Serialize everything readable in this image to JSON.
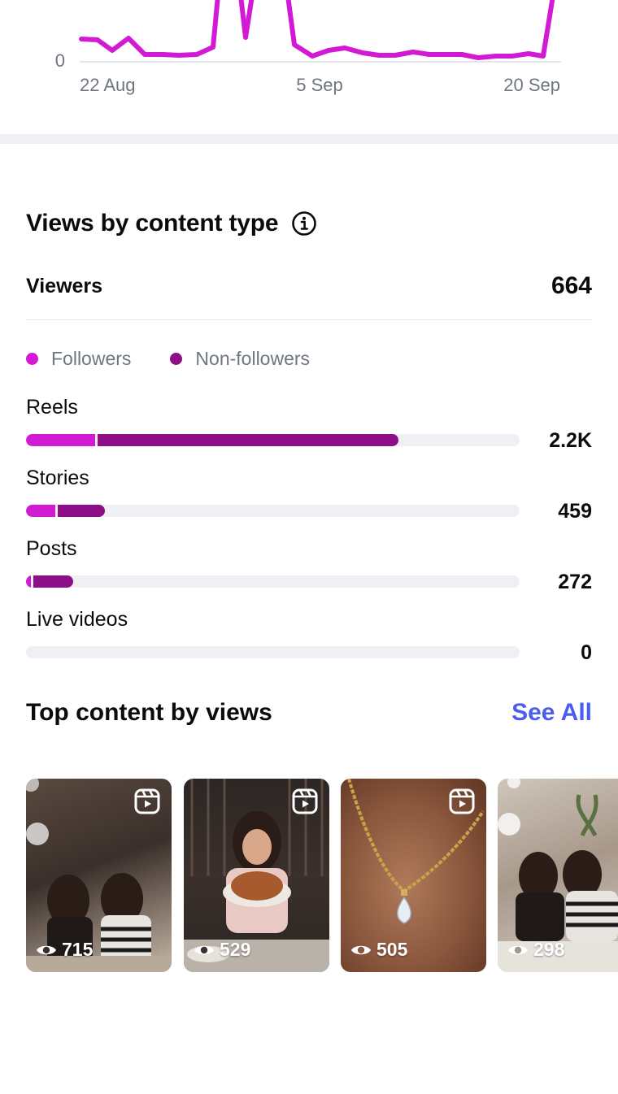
{
  "trend_chart": {
    "y_tick": "0",
    "x_ticks": [
      "22 Aug",
      "5 Sep",
      "20 Sep"
    ],
    "line_color": "#d21ad4"
  },
  "views_by_type": {
    "title": "Views by content type",
    "info_icon": "info-icon",
    "viewers_label": "Viewers",
    "viewers_value": "664",
    "legend": [
      {
        "label": "Followers",
        "color": "#d21ad4"
      },
      {
        "label": "Non-followers",
        "color": "#8e0e88"
      }
    ],
    "rows": [
      {
        "label": "Reels",
        "value": "2.2K",
        "followers_fraction": 0.14,
        "nonfollowers_fraction": 0.61
      },
      {
        "label": "Stories",
        "value": "459",
        "followers_fraction": 0.06,
        "nonfollowers_fraction": 0.095
      },
      {
        "label": "Posts",
        "value": "272",
        "followers_fraction": 0.01,
        "nonfollowers_fraction": 0.08
      },
      {
        "label": "Live videos",
        "value": "0",
        "followers_fraction": 0,
        "nonfollowers_fraction": 0
      }
    ]
  },
  "top_content": {
    "title": "Top content by views",
    "see_all": "See All",
    "items": [
      {
        "views": "715",
        "reel": true
      },
      {
        "views": "529",
        "reel": true
      },
      {
        "views": "505",
        "reel": true
      },
      {
        "views": "298",
        "reel": false
      }
    ]
  }
}
